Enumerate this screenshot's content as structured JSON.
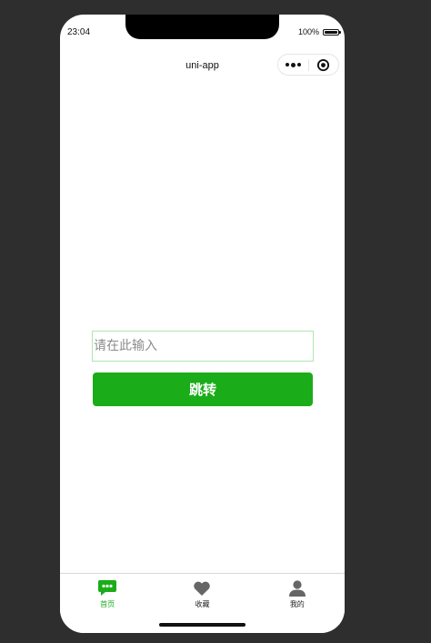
{
  "status_bar": {
    "time": "23:04",
    "battery": "100%"
  },
  "nav_bar": {
    "title": "uni-app",
    "capsule_icons": [
      "more-dots-icon",
      "close-target-icon"
    ]
  },
  "form": {
    "input_placeholder": "请在此输入",
    "input_value": "",
    "button_label": "跳转"
  },
  "tabbar": {
    "items": [
      {
        "label": "首页",
        "icon": "chat-bubble-icon",
        "active": true
      },
      {
        "label": "收藏",
        "icon": "heart-icon",
        "active": false
      },
      {
        "label": "我的",
        "icon": "person-icon",
        "active": false
      }
    ]
  },
  "colors": {
    "primary_green": "#1aad19",
    "inactive_icon": "#666666",
    "input_border": "#aee8ae",
    "backdrop": "#2e2e2e"
  }
}
